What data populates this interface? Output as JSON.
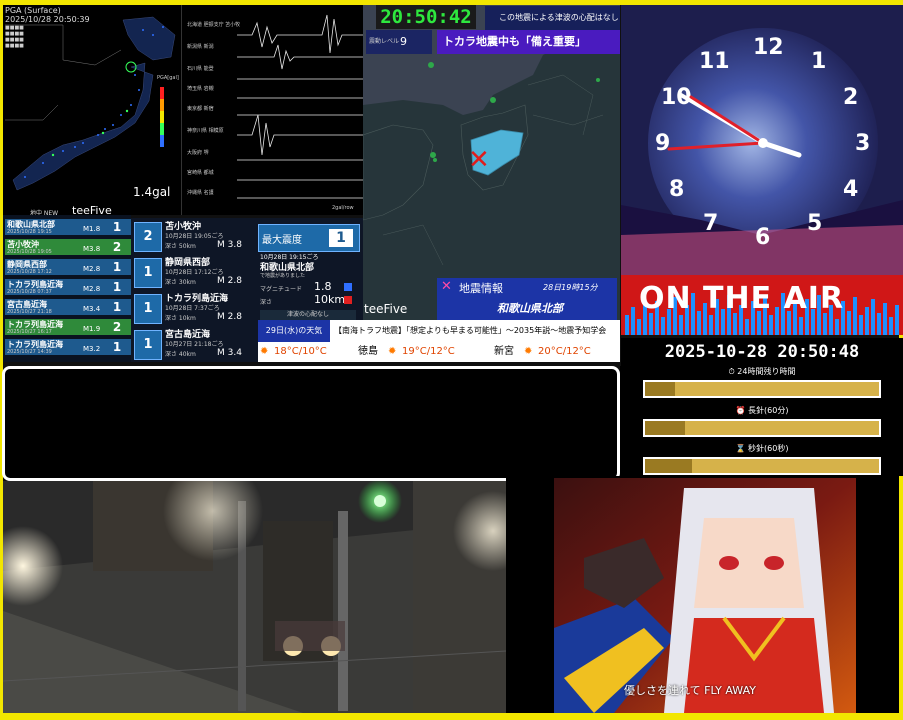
{
  "frame_color": "#f2e600",
  "japan_map": {
    "header_line1": "PGA (Surface)",
    "header_line2": "2025/10/28 20:50:39",
    "gal": "1.4gal",
    "scale_label": "PGA[gal]"
  },
  "seismograms": {
    "stations": [
      "北海道 胆振支庁 苫小牧",
      "新潟県 新潟",
      "石川県 能登",
      "埼玉県 岩槻",
      "東京都 新宿",
      "神奈川県 相模原",
      "大阪府 堺",
      "宮崎県 都城",
      "沖縄県 名護"
    ],
    "footer_right": "2gal/row"
  },
  "eq_list": {
    "title": "地中 NEW",
    "brand": "teeFive",
    "items": [
      {
        "loc": "和歌山県北部",
        "date": "2025/10/28 19:15",
        "mag": "M1.8",
        "intensity": "1"
      },
      {
        "loc": "苫小牧沖",
        "date": "2025/10/28 19:05",
        "mag": "M3.8",
        "intensity": "2"
      },
      {
        "loc": "静岡県西部",
        "date": "2025/10/28 17:12",
        "mag": "M2.8",
        "intensity": "1"
      },
      {
        "loc": "トカラ列島近海",
        "date": "2025/10/28 07:37",
        "mag": "M2.8",
        "intensity": "1"
      },
      {
        "loc": "宮古島近海",
        "date": "2025/10/27 21:18",
        "mag": "M3.4",
        "intensity": "1"
      },
      {
        "loc": "トカラ列島近海",
        "date": "2025/10/27 16:17",
        "mag": "M1.9",
        "intensity": "2"
      },
      {
        "loc": "トカラ列島近海",
        "date": "2025/10/27 14:39",
        "mag": "M3.2",
        "intensity": "1"
      }
    ]
  },
  "details": [
    {
      "intensity": "2",
      "loc": "苫小牧沖",
      "time": "10月28日 19:05ごろ",
      "depth": "深さ 50km",
      "mag": "M 3.8"
    },
    {
      "intensity": "1",
      "loc": "静岡県西部",
      "time": "10月28日 17:12ごろ",
      "depth": "深さ 30km",
      "mag": "M 2.8"
    },
    {
      "intensity": "1",
      "loc": "トカラ列島近海",
      "time": "10月28日 7:37ごろ",
      "depth": "深さ 10km",
      "mag": "M 2.8"
    },
    {
      "intensity": "1",
      "loc": "宮古島近海",
      "time": "10月27日 21:18ごろ",
      "depth": "深さ 40km",
      "mag": "M 3.4"
    }
  ],
  "max_intensity": {
    "label": "最大震度",
    "value": "1",
    "time": "10月28日 19:15ごろ",
    "loc": "和歌山県北部",
    "sub": "で地震がありました",
    "mag_label": "マグニチュード",
    "mag_value": "1.8",
    "depth_label": "深さ",
    "depth_value": "10km",
    "tsunami": "津波の心配なし"
  },
  "regional": {
    "clock": "20:50:42",
    "tsunami_note": "この地震による津波の心配はなし",
    "level_label": "震動レベル",
    "level_value": "9",
    "banner": "トカラ地震中も「備え重要」",
    "info_title": "地震情報",
    "info_time": "28日19時15分",
    "info_loc": "和歌山県北部",
    "brand": "teeFive",
    "epicenter_marker": "✕"
  },
  "weather": {
    "title": "29日(水)の天気",
    "news": "【南海トラフ地震】「想定よりも早まる可能性」〜2035年説〜地震予知学会",
    "cities": [
      {
        "name": "",
        "temp": "18°C/10°C"
      },
      {
        "name": "徳島",
        "temp": "19°C/12°C"
      },
      {
        "name": "新宮",
        "temp": "20°C/12°C"
      }
    ],
    "sun_icon": "sun-icon"
  },
  "clock": {
    "numerals": [
      "12",
      "1",
      "2",
      "3",
      "4",
      "5",
      "6",
      "7",
      "8",
      "9",
      "10",
      "11"
    ],
    "onair": "ON THE AIR",
    "datetime": "2025-10-28 20:50:48"
  },
  "progress": [
    {
      "icon": "⏱",
      "label": "24時間残り時間",
      "fraction": 0.13
    },
    {
      "icon": "⏰",
      "label": "長針(60分)",
      "fraction": 0.17
    },
    {
      "icon": "⌛",
      "label": "秒針(60秒)",
      "fraction": 0.2
    }
  ],
  "lyric": "優しさを連れて FLY AWAY"
}
